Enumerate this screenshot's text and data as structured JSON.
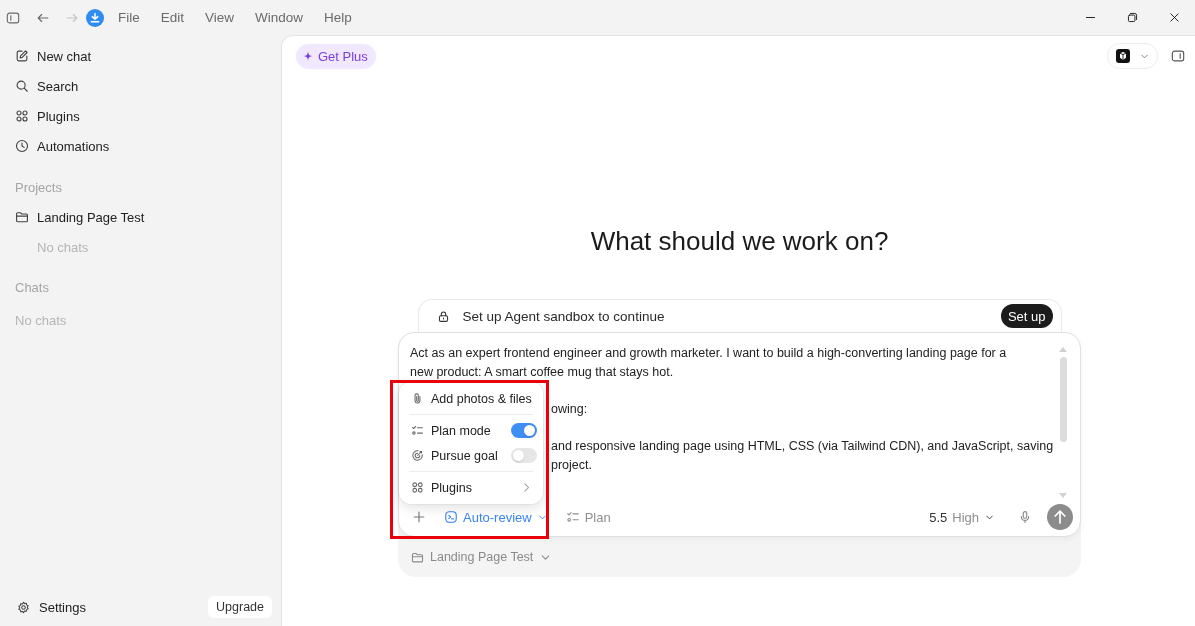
{
  "titlebar": {
    "history": {
      "back_disabled": false,
      "forward_disabled": true
    },
    "menu": [
      "File",
      "Edit",
      "View",
      "Window",
      "Help"
    ]
  },
  "sidebar": {
    "nav": [
      "New chat",
      "Search",
      "Plugins",
      "Automations"
    ],
    "projects": {
      "heading": "Projects",
      "items": [
        {
          "label": "Landing Page Test",
          "empty_note": "No chats"
        }
      ]
    },
    "chats": {
      "heading": "Chats",
      "empty_note": "No chats"
    },
    "settings": "Settings",
    "upgrade": "Upgrade"
  },
  "topbar": {
    "get_plus": "Get Plus"
  },
  "heading": "What should we work on?",
  "sandbox_banner": {
    "text": "Set up Agent sandbox to continue",
    "button": "Set up"
  },
  "composer": {
    "paragraphs": [
      {
        "kind": "full",
        "lines": [
          "Act as an expert frontend engineer and growth marketer. I want to build a high-converting landing page for a",
          "new product: A smart coffee mug that stays hot."
        ]
      },
      {
        "kind": "behind-menu",
        "lines": [
          "owing:"
        ]
      },
      {
        "kind": "behind-menu",
        "lines": [
          "and responsive landing page using HTML, CSS (via Tailwind CDN), and JavaScript, saving",
          "project."
        ]
      }
    ],
    "menu": {
      "items": [
        {
          "kind": "action",
          "label": "Add photos & files"
        },
        {
          "kind": "toggle",
          "label": "Plan mode",
          "on": true
        },
        {
          "kind": "toggle",
          "label": "Pursue goal",
          "on": false
        },
        {
          "kind": "submenu",
          "label": "Plugins"
        }
      ]
    },
    "toolbar": {
      "review_mode": "Auto-review",
      "plan": "Plan",
      "model": "5.5",
      "effort": "High"
    }
  },
  "project_selector": "Landing Page Test"
}
